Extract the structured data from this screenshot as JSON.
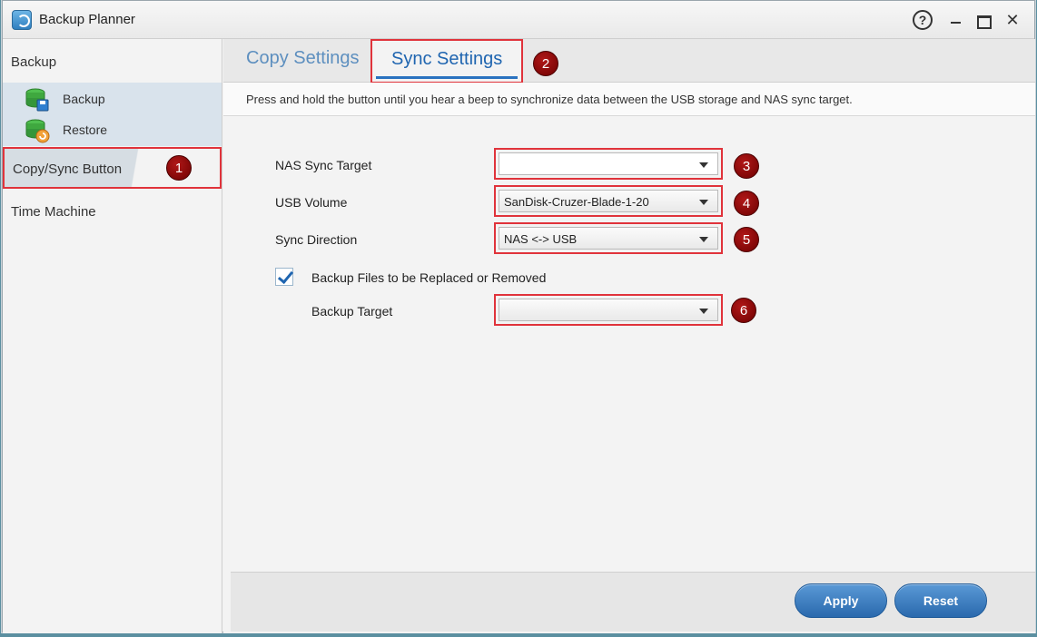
{
  "window": {
    "title": "Backup Planner",
    "help_icon": "?",
    "close_icon": "✕"
  },
  "sidebar": {
    "group_label": "Backup",
    "sub_items": [
      {
        "label": "Backup",
        "icon": "database-save-icon"
      },
      {
        "label": "Restore",
        "icon": "database-restore-icon"
      }
    ],
    "items": [
      {
        "label": "Copy/Sync Button",
        "active": true
      },
      {
        "label": "Time Machine",
        "active": false
      }
    ]
  },
  "tabs": [
    {
      "label": "Copy Settings",
      "active": false
    },
    {
      "label": "Sync Settings",
      "active": true
    }
  ],
  "description": "Press and hold the button until you hear a beep to synchronize data between the USB storage and NAS sync target.",
  "form": {
    "nas_sync_target": {
      "label": "NAS Sync Target",
      "value": ""
    },
    "usb_volume": {
      "label": "USB Volume",
      "value": "SanDisk-Cruzer-Blade-1-20"
    },
    "sync_direction": {
      "label": "Sync Direction",
      "value": "NAS <-> USB"
    },
    "backup_replaced": {
      "label": "Backup Files to be Replaced or Removed",
      "checked": true
    },
    "backup_target": {
      "label": "Backup Target",
      "value": ""
    }
  },
  "buttons": {
    "apply": "Apply",
    "reset": "Reset"
  },
  "badges": [
    "1",
    "2",
    "3",
    "4",
    "5",
    "6"
  ],
  "colors": {
    "highlight": "#e0333b",
    "badge": "#8b0000",
    "accent": "#2a72c0"
  }
}
